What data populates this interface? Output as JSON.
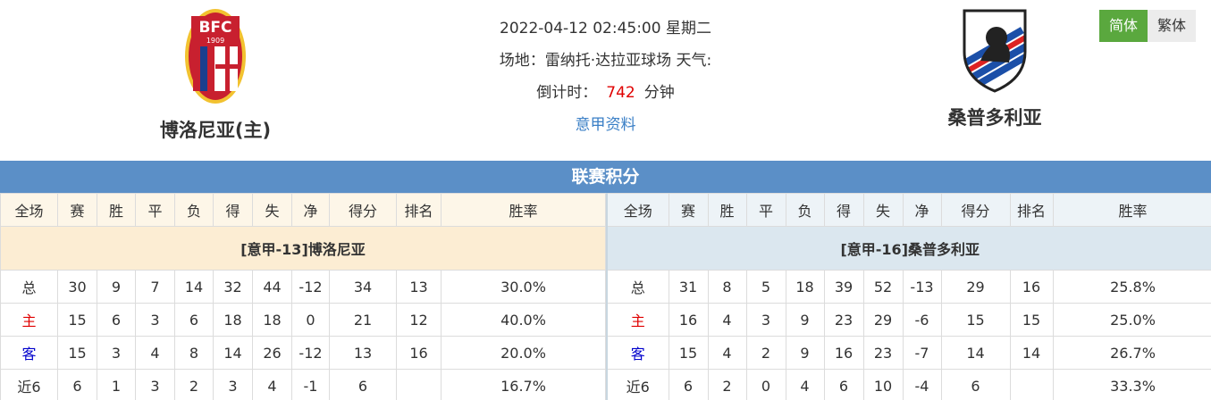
{
  "match": {
    "datetime": "2022-04-12 02:45:00",
    "weekday": "星期二",
    "venue_label": "场地：",
    "venue": "雷纳托·达拉亚球场",
    "weather_label": "天气:",
    "countdown_label": "倒计时：",
    "countdown_value": "742",
    "countdown_unit": "分钟",
    "league_link": "意甲资料"
  },
  "home_team": {
    "name": "博洛尼亚(主)",
    "crest_text": "BFC",
    "crest_year": "1909",
    "crest_icon": "bologna-crest-icon"
  },
  "away_team": {
    "name": "桑普多利亚",
    "crest_icon": "sampdoria-crest-icon"
  },
  "lang": {
    "simplified": "简体",
    "traditional": "繁体"
  },
  "section_title": "联赛积分",
  "columns": [
    "全场",
    "赛",
    "胜",
    "平",
    "负",
    "得",
    "失",
    "净",
    "得分",
    "排名",
    "胜率"
  ],
  "home_table": {
    "caption": "[意甲-13]博洛尼亚",
    "rows": [
      [
        "总",
        "30",
        "9",
        "7",
        "14",
        "32",
        "44",
        "-12",
        "34",
        "13",
        "30.0%"
      ],
      [
        "主",
        "15",
        "6",
        "3",
        "6",
        "18",
        "18",
        "0",
        "21",
        "12",
        "40.0%"
      ],
      [
        "客",
        "15",
        "3",
        "4",
        "8",
        "14",
        "26",
        "-12",
        "13",
        "16",
        "20.0%"
      ],
      [
        "近6",
        "6",
        "1",
        "3",
        "2",
        "3",
        "4",
        "-1",
        "6",
        "",
        "16.7%"
      ]
    ]
  },
  "away_table": {
    "caption": "[意甲-16]桑普多利亚",
    "rows": [
      [
        "总",
        "31",
        "8",
        "5",
        "18",
        "39",
        "52",
        "-13",
        "29",
        "16",
        "25.8%"
      ],
      [
        "主",
        "16",
        "4",
        "3",
        "9",
        "23",
        "29",
        "-6",
        "15",
        "15",
        "25.0%"
      ],
      [
        "客",
        "15",
        "4",
        "2",
        "9",
        "16",
        "23",
        "-7",
        "14",
        "14",
        "26.7%"
      ],
      [
        "近6",
        "6",
        "2",
        "0",
        "4",
        "6",
        "10",
        "-4",
        "6",
        "",
        "33.3%"
      ]
    ]
  },
  "colors": {
    "accent_green": "#5aa83e",
    "banner_blue": "#5b8fc7",
    "home_red": "#e00000",
    "away_blue": "#0000cc",
    "link_blue": "#3a7fc6"
  }
}
